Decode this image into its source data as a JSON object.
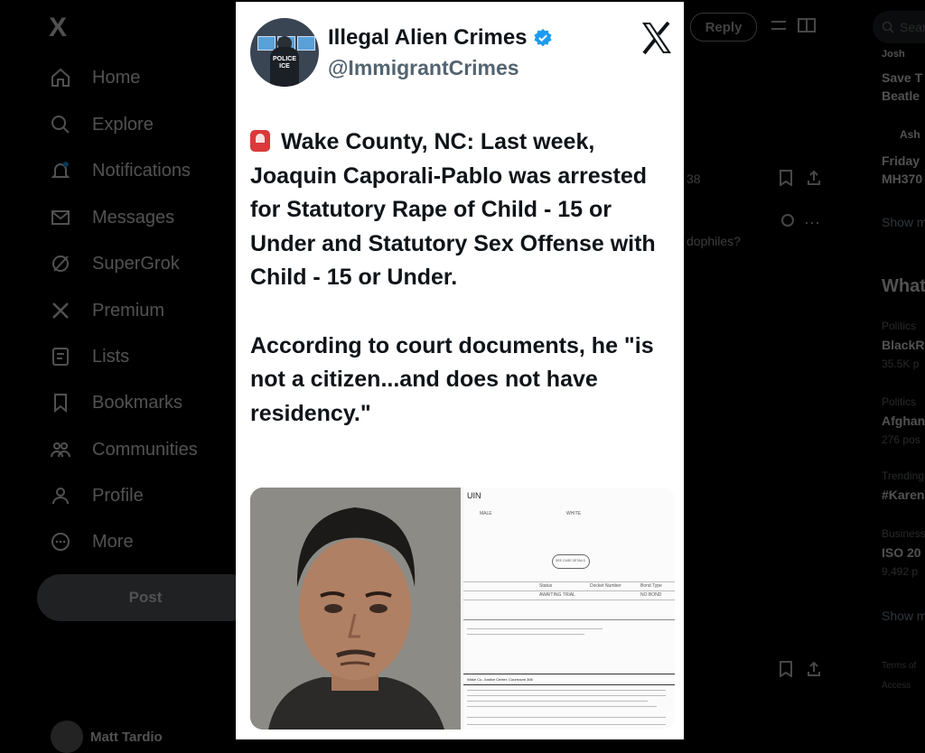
{
  "sidebar": {
    "logo": "X",
    "items": [
      {
        "label": "Home",
        "icon": "home-icon"
      },
      {
        "label": "Explore",
        "icon": "search-icon"
      },
      {
        "label": "Notifications",
        "icon": "bell-icon"
      },
      {
        "label": "Messages",
        "icon": "envelope-icon"
      },
      {
        "label": "SuperGrok",
        "icon": "grok-icon"
      },
      {
        "label": "Premium",
        "icon": "x-logo-icon"
      },
      {
        "label": "Lists",
        "icon": "list-icon"
      },
      {
        "label": "Bookmarks",
        "icon": "bookmark-icon"
      },
      {
        "label": "Communities",
        "icon": "people-icon"
      },
      {
        "label": "Profile",
        "icon": "person-icon"
      },
      {
        "label": "More",
        "icon": "more-circle-icon"
      }
    ],
    "post_label": "Post",
    "account_name": "Matt Tardio"
  },
  "thread": {
    "reply_label": "Reply",
    "partial_reply": "dophiles?",
    "count": "38"
  },
  "right_column": {
    "search_placeholder": "Sear",
    "fragments": [
      {
        "text": "Josh",
        "bold": true
      },
      {
        "text": "Save T",
        "bold": true
      },
      {
        "text": "Beatle",
        "bold": true
      },
      {
        "text": "Ash",
        "bold": true
      },
      {
        "text": "Friday",
        "bold": true
      },
      {
        "text": "MH370",
        "bold": true
      },
      {
        "text": "Show m",
        "bold": false
      },
      {
        "text": "What",
        "bold": true
      },
      {
        "text": "Politics",
        "bold": false
      },
      {
        "text": "BlackR",
        "bold": true
      },
      {
        "text": "35.5K p",
        "bold": false
      },
      {
        "text": "Politics",
        "bold": false
      },
      {
        "text": "Afghan",
        "bold": true
      },
      {
        "text": "276 pos",
        "bold": false
      },
      {
        "text": "Trending",
        "bold": false
      },
      {
        "text": "#Karen",
        "bold": true
      },
      {
        "text": "Business",
        "bold": false
      },
      {
        "text": "ISO 20",
        "bold": true
      },
      {
        "text": "9,492 p",
        "bold": false
      },
      {
        "text": "Show m",
        "bold": false
      },
      {
        "text": "Terms of",
        "bold": false
      },
      {
        "text": "Access",
        "bold": false
      }
    ]
  },
  "tweet": {
    "display_name": "Illegal Alien Crimes",
    "handle": "@ImmigrantCrimes",
    "avatar_badge_line1": "POLICE",
    "avatar_badge_line2": "ICE",
    "paragraph1": "Wake County, NC: Last week, Joaquin Caporali-Pablo was arrested for Statutory Rape of Child - 15 or Under and Statutory Sex Offense with Child - 15 or Under.",
    "paragraph2": "According to court documents, he \"is not a citizen...and does not have residency.\"",
    "doc_header": "UIN",
    "doc_fields": [
      "MALE",
      "WHITE",
      "SEE CASE DETAILS",
      "Status",
      "Docket Number",
      "Bond Type",
      "AWAITING TRIAL",
      "NO BOND"
    ],
    "doc_footer": "Wake Co. Justice Center, Courtroom 306"
  },
  "colors": {
    "accent": "#1d9bf0",
    "text": "#0f1419",
    "secondary": "#536471",
    "siren": "#d93a3a"
  }
}
